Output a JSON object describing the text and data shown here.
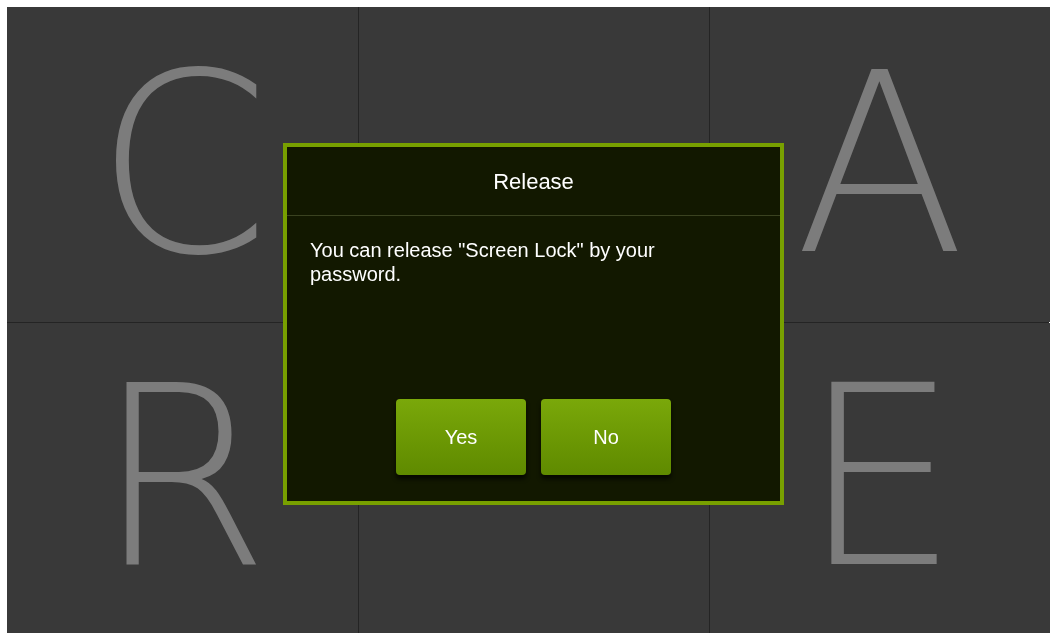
{
  "tiles": [
    {
      "kind": "letter",
      "letter": "C"
    },
    {
      "kind": "blank"
    },
    {
      "kind": "letter",
      "letter": "A"
    },
    {
      "kind": "letter",
      "letter": "R"
    },
    {
      "kind": "blank"
    },
    {
      "kind": "letter",
      "letter": "E"
    }
  ],
  "dialog": {
    "title": "Release",
    "message": "You can release \"Screen Lock\" by your password.",
    "buttons": [
      {
        "label": "Yes"
      },
      {
        "label": "No"
      }
    ]
  }
}
